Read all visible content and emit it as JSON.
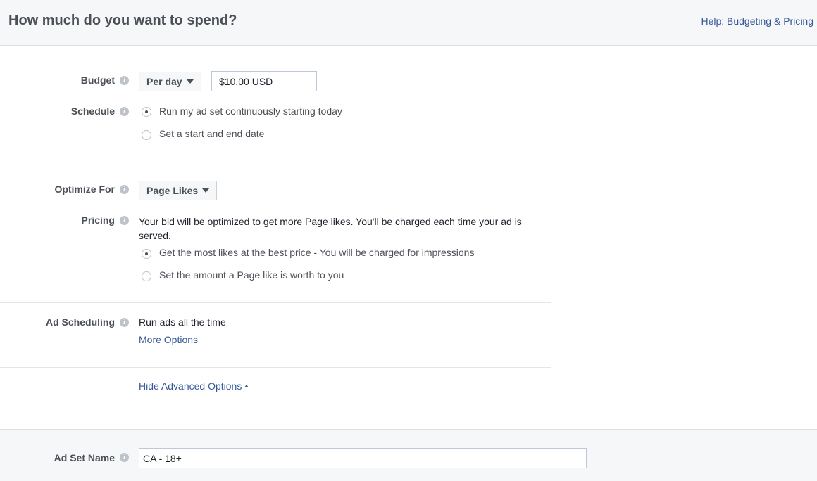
{
  "header": {
    "title": "How much do you want to spend?",
    "help_link": "Help: Budgeting & Pricing"
  },
  "budget": {
    "label": "Budget",
    "period_selected": "Per day",
    "amount_value": "$10.00 USD"
  },
  "schedule": {
    "label": "Schedule",
    "options": [
      {
        "label": "Run my ad set continuously starting today",
        "checked": true
      },
      {
        "label": "Set a start and end date",
        "checked": false
      }
    ]
  },
  "optimize": {
    "label": "Optimize For",
    "selected": "Page Likes"
  },
  "pricing": {
    "label": "Pricing",
    "description": "Your bid will be optimized to get more Page likes. You'll be charged each time your ad is served.",
    "options": [
      {
        "label": "Get the most likes at the best price - You will be charged for impressions",
        "checked": true
      },
      {
        "label": "Set the amount a Page like is worth to you",
        "checked": false
      }
    ]
  },
  "ad_scheduling": {
    "label": "Ad Scheduling",
    "value": "Run ads all the time",
    "more_options": "More Options"
  },
  "advanced": {
    "toggle_label": "Hide Advanced Options"
  },
  "ad_set_name": {
    "label": "Ad Set Name",
    "value": "CA - 18+"
  },
  "info_glyph": "i",
  "colors": {
    "link": "#365899",
    "label": "#4b4f56",
    "header_bg": "#f6f7f9"
  }
}
